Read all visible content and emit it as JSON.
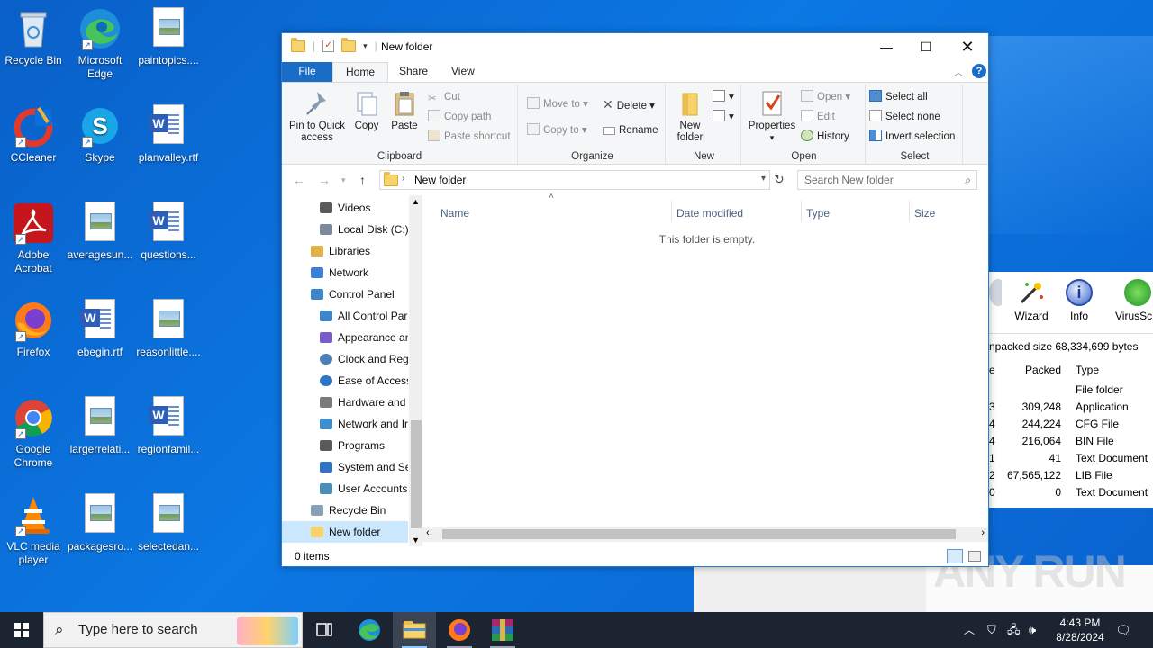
{
  "desktop": {
    "icons": [
      {
        "label": "Recycle Bin"
      },
      {
        "label": "Microsoft Edge"
      },
      {
        "label": "paintopics...."
      },
      {
        "label": "CCleaner"
      },
      {
        "label": "Skype"
      },
      {
        "label": "planvalley.rtf"
      },
      {
        "label": "Adobe Acrobat"
      },
      {
        "label": "averagesun..."
      },
      {
        "label": "questions..."
      },
      {
        "label": "Firefox"
      },
      {
        "label": "ebegin.rtf"
      },
      {
        "label": "reasonlittle...."
      },
      {
        "label": "Google Chrome"
      },
      {
        "label": "largerrelati..."
      },
      {
        "label": "regionfamil..."
      },
      {
        "label": "VLC media player"
      },
      {
        "label": "packagesro..."
      },
      {
        "label": "selectedan..."
      }
    ]
  },
  "explorer": {
    "title": "New folder",
    "tabs": {
      "file": "File",
      "home": "Home",
      "share": "Share",
      "view": "View"
    },
    "ribbon": {
      "clipboard": {
        "label": "Clipboard",
        "pin": "Pin to Quick access",
        "copy": "Copy",
        "paste": "Paste",
        "cut": "Cut",
        "copy_path": "Copy path",
        "paste_shortcut": "Paste shortcut"
      },
      "organize": {
        "label": "Organize",
        "move_to": "Move to",
        "copy_to": "Copy to",
        "delete": "Delete",
        "rename": "Rename"
      },
      "new": {
        "label": "New",
        "new_folder": "New folder"
      },
      "open": {
        "label": "Open",
        "properties": "Properties",
        "open": "Open",
        "edit": "Edit",
        "history": "History"
      },
      "select": {
        "label": "Select",
        "select_all": "Select all",
        "select_none": "Select none",
        "invert": "Invert selection"
      }
    },
    "address": {
      "path": "New folder",
      "search_placeholder": "Search New folder"
    },
    "nav": [
      {
        "label": "Videos",
        "color": "#5a5a5a"
      },
      {
        "label": "Local Disk (C:)",
        "color": "#7a8a9a"
      },
      {
        "label": "Libraries",
        "color": "#e0b24a"
      },
      {
        "label": "Network",
        "color": "#3d7fd0"
      },
      {
        "label": "Control Panel",
        "color": "#3f86c9"
      },
      {
        "label": "All Control Par",
        "color": "#3f86c9"
      },
      {
        "label": "Appearance an",
        "color": "#7a5cc8"
      },
      {
        "label": "Clock and Regi",
        "color": "#4a7fb8"
      },
      {
        "label": "Ease of Access",
        "color": "#2f74c4"
      },
      {
        "label": "Hardware and",
        "color": "#7a7a7a"
      },
      {
        "label": "Network and Ir",
        "color": "#3d8fd0"
      },
      {
        "label": "Programs",
        "color": "#5a5a5a"
      },
      {
        "label": "System and Sec",
        "color": "#2f74c4"
      },
      {
        "label": "User Accounts",
        "color": "#4a8fb8"
      },
      {
        "label": "Recycle Bin",
        "color": "#8aa0b8"
      },
      {
        "label": "New folder",
        "color": "#f7d36b"
      }
    ],
    "columns": {
      "name": "Name",
      "date": "Date modified",
      "type": "Type",
      "size": "Size"
    },
    "empty_text": "This folder is empty.",
    "status": "0 items"
  },
  "background_app": {
    "tools": [
      {
        "label": "Wizard"
      },
      {
        "label": "Info"
      },
      {
        "label": "VirusSc"
      }
    ],
    "packed_info": "npacked size 68,334,699 bytes",
    "headers": {
      "c0": "e",
      "packed": "Packed",
      "type": "Type"
    },
    "rows": [
      {
        "c0": "",
        "packed": "",
        "type": "File folder"
      },
      {
        "c0": "3",
        "packed": "309,248",
        "type": "Application"
      },
      {
        "c0": "4",
        "packed": "244,224",
        "type": "CFG File"
      },
      {
        "c0": "4",
        "packed": "216,064",
        "type": "BIN File"
      },
      {
        "c0": "1",
        "packed": "41",
        "type": "Text Document"
      },
      {
        "c0": "2",
        "packed": "67,565,122",
        "type": "LIB File"
      },
      {
        "c0": "0",
        "packed": "0",
        "type": "Text Document"
      }
    ]
  },
  "watermark": "ANY RUN",
  "taskbar": {
    "search_placeholder": "Type here to search",
    "time": "4:43 PM",
    "date": "8/28/2024"
  }
}
